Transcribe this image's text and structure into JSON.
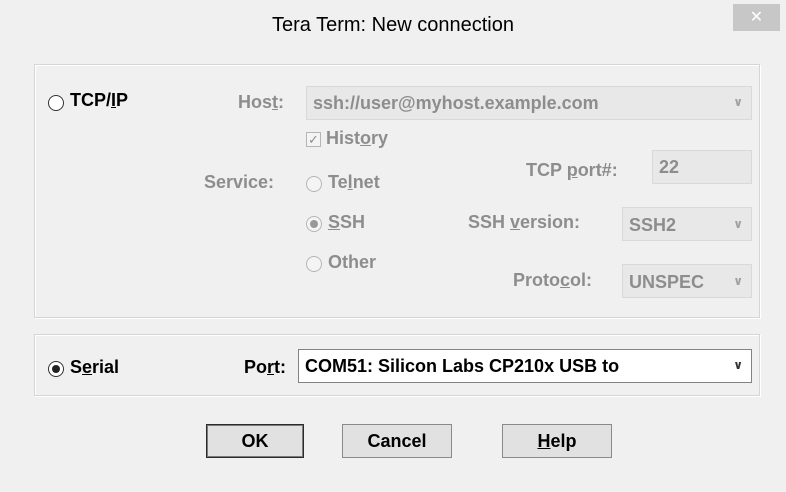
{
  "window": {
    "title": "Tera Term: New connection",
    "close_glyph": "✕"
  },
  "tcpip": {
    "radio_label": "TCP/IP",
    "radio_label_mnemonic_index": 4,
    "host_label": "Host:",
    "host_value": "ssh://user@myhost.example.com",
    "history_label": "History",
    "history_checked": true,
    "service_label": "Service:",
    "services": [
      "Telnet",
      "SSH",
      "Other"
    ],
    "selected_service": "SSH",
    "tcp_port_label": "TCP port#:",
    "tcp_port_value": "22",
    "ssh_version_label": "SSH version:",
    "ssh_version_value": "SSH2",
    "protocol_label": "Protocol:",
    "protocol_value": "UNSPEC"
  },
  "serial": {
    "radio_label": "Serial",
    "selected": true,
    "port_label": "Port:",
    "port_value": "COM51: Silicon Labs CP210x USB to"
  },
  "buttons": {
    "ok": "OK",
    "cancel": "Cancel",
    "help": "Help"
  },
  "icons": {
    "dropdown": "chevron-down-icon",
    "close": "close-icon",
    "check": "checkmark-icon"
  }
}
